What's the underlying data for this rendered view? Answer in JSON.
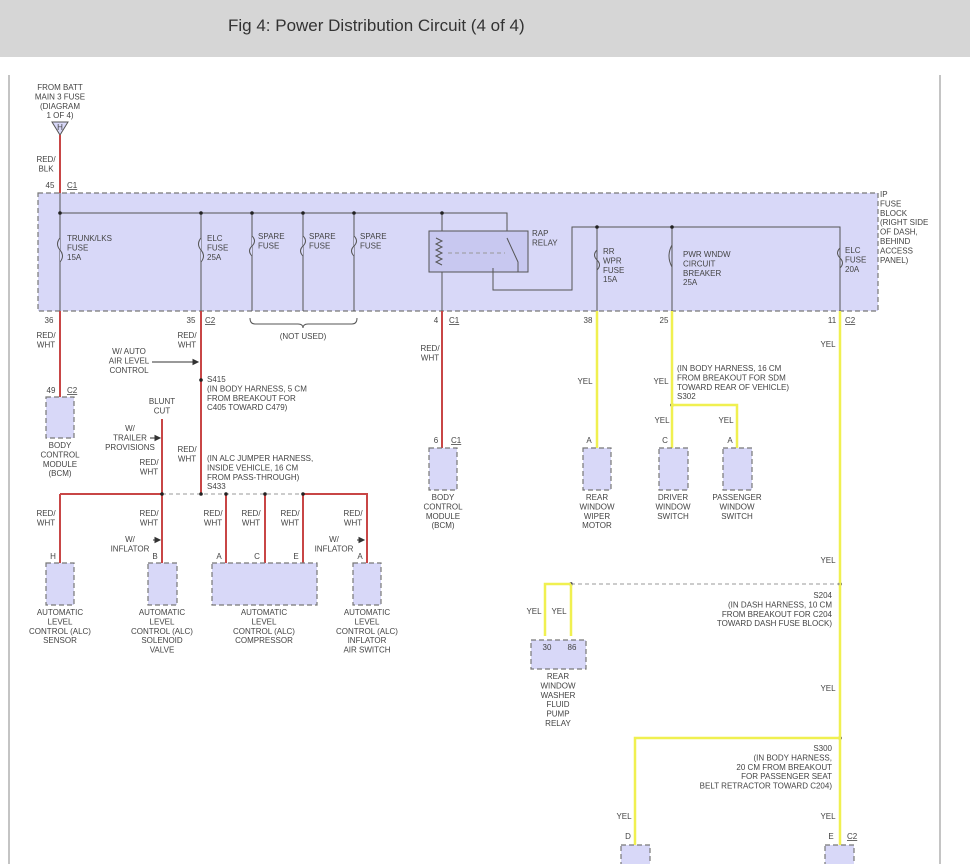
{
  "header": {
    "title": "Fig 4: Power Distribution Circuit (4 of 4)"
  },
  "colors": {
    "fuse_block": "#d8d8f8",
    "red_wht_wire": "#c84646",
    "yel_wire": "#f0f050",
    "header_bg": "#d6d6d6"
  },
  "labels": {
    "from_batt": [
      "FROM BATT",
      "MAIN 3 FUSE",
      "(DIAGRAM",
      "1 OF 4)"
    ],
    "batt_terminal": [
      "H"
    ],
    "red_blk": [
      "RED/",
      "BLK"
    ],
    "c1_45": [
      "45"
    ],
    "c1_45_conn": [
      "C1"
    ],
    "trunk_fuse": [
      "TRUNK/LKS",
      "FUSE",
      "15A"
    ],
    "elc_fuse_25": [
      "ELC",
      "FUSE",
      "25A"
    ],
    "spare1": [
      "SPARE",
      "FUSE"
    ],
    "spare2": [
      "SPARE",
      "FUSE"
    ],
    "spare3": [
      "SPARE",
      "FUSE"
    ],
    "rap_relay": [
      "RAP",
      "RELAY"
    ],
    "rr_wpr": [
      "RR",
      "WPR",
      "FUSE",
      "15A"
    ],
    "pwr_wndw": [
      "PWR WNDW",
      "CIRCUIT",
      "BREAKER",
      "25A"
    ],
    "elc_fuse_20": [
      "ELC",
      "FUSE",
      "20A"
    ],
    "ip_fuse_block": [
      "IP",
      "FUSE",
      "BLOCK",
      "(RIGHT SIDE",
      "OF DASH,",
      "BEHIND",
      "ACCESS",
      "PANEL)"
    ],
    "pin36": [
      "36"
    ],
    "pin35": [
      "35"
    ],
    "c2a": [
      "C2"
    ],
    "not_used": [
      "(NOT USED)"
    ],
    "pin4": [
      "4"
    ],
    "c1b": [
      "C1"
    ],
    "pin38": [
      "38"
    ],
    "pin25": [
      "25"
    ],
    "pin11": [
      "11"
    ],
    "c2b": [
      "C2"
    ],
    "rw1": [
      "RED/",
      "WHT"
    ],
    "rw2": [
      "RED/",
      "WHT"
    ],
    "rw3": [
      "RED/",
      "WHT"
    ],
    "pin49": [
      "49"
    ],
    "c2c": [
      "C2"
    ],
    "bcm1": [
      "BODY",
      "CONTROL",
      "MODULE",
      "(BCM)"
    ],
    "auto_air": [
      "W/ AUTO",
      "AIR LEVEL",
      "CONTROL"
    ],
    "s415": [
      "S415",
      "(IN BODY HARNESS, 5 CM",
      "FROM BREAKOUT FOR",
      "C405 TOWARD C479)"
    ],
    "blunt_cut": [
      "BLUNT",
      "CUT"
    ],
    "trailer": [
      "W/",
      "TRAILER",
      "PROVISIONS"
    ],
    "rw4": [
      "RED/",
      "WHT"
    ],
    "rw5": [
      "RED/",
      "WHT"
    ],
    "s433": [
      "(IN ALC JUMPER HARNESS,",
      "INSIDE VEHICLE, 16 CM",
      "FROM PASS-THROUGH)",
      "S433"
    ],
    "rw6": [
      "RED/",
      "WHT"
    ],
    "rw7": [
      "RED/",
      "WHT"
    ],
    "rw8": [
      "RED/",
      "WHT"
    ],
    "rw9": [
      "RED/",
      "WHT"
    ],
    "rw10": [
      "RED/",
      "WHT"
    ],
    "rw11": [
      "RED/",
      "WHT"
    ],
    "inflator1": [
      "W/",
      "INFLATOR"
    ],
    "inflator2": [
      "W/",
      "INFLATOR"
    ],
    "pH": [
      "H"
    ],
    "pB": [
      "B"
    ],
    "pA1": [
      "A"
    ],
    "pC1": [
      "C"
    ],
    "pE1": [
      "E"
    ],
    "pA2": [
      "A"
    ],
    "alc_sensor": [
      "AUTOMATIC",
      "LEVEL",
      "CONTROL (ALC)",
      "SENSOR"
    ],
    "alc_solenoid": [
      "AUTOMATIC",
      "LEVEL",
      "CONTROL (ALC)",
      "SOLENOID",
      "VALVE"
    ],
    "alc_compressor": [
      "AUTOMATIC",
      "LEVEL",
      "CONTROL (ALC)",
      "COMPRESSOR"
    ],
    "alc_inflator": [
      "AUTOMATIC",
      "LEVEL",
      "CONTROL (ALC)",
      "INFLATOR",
      "AIR SWITCH"
    ],
    "pin6": [
      "6"
    ],
    "c1c": [
      "C1"
    ],
    "bcm2": [
      "BODY",
      "CONTROL",
      "MODULE",
      "(BCM)"
    ],
    "yel1": [
      "YEL"
    ],
    "yel2": [
      "YEL"
    ],
    "yel3": [
      "YEL"
    ],
    "yel4": [
      "YEL"
    ],
    "yel5": [
      "YEL"
    ],
    "s302": [
      "(IN BODY HARNESS, 16 CM",
      "FROM BREAKOUT FOR SDM",
      "TOWARD REAR OF VEHICLE)",
      "S302"
    ],
    "pA3": [
      "A"
    ],
    "pC2": [
      "C"
    ],
    "pA4": [
      "A"
    ],
    "wiper_motor": [
      "REAR",
      "WINDOW",
      "WIPER",
      "MOTOR"
    ],
    "driver_switch": [
      "DRIVER",
      "WINDOW",
      "SWITCH"
    ],
    "pass_switch": [
      "PASSENGER",
      "WINDOW",
      "SWITCH"
    ],
    "yel6": [
      "YEL"
    ],
    "yel7": [
      "YEL"
    ],
    "yel8": [
      "YEL"
    ],
    "yel9": [
      "YEL"
    ],
    "yel10": [
      "YEL"
    ],
    "yel11": [
      "YEL"
    ],
    "yel12": [
      "YEL"
    ],
    "s204": [
      "S204",
      "(IN DASH HARNESS, 10 CM",
      "FROM BREAKOUT FOR C204",
      "TOWARD DASH FUSE BLOCK)"
    ],
    "p30": [
      "30"
    ],
    "p86": [
      "86"
    ],
    "washer_relay": [
      "REAR",
      "WINDOW",
      "WASHER",
      "FLUID",
      "PUMP",
      "RELAY"
    ],
    "s300": [
      "S300",
      "(IN BODY HARNESS,",
      "20 CM FROM BREAKOUT",
      "FOR PASSENGER SEAT",
      "BELT RETRACTOR TOWARD C204)"
    ],
    "pD": [
      "D"
    ],
    "pE2": [
      "E"
    ],
    "c2d": [
      "C2"
    ]
  }
}
